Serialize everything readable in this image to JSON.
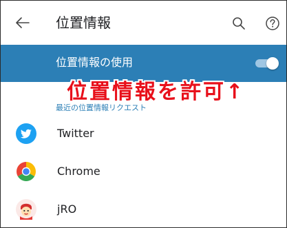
{
  "header": {
    "title": "位置情報",
    "back_icon": "arrow-left-icon",
    "search_icon": "search-icon",
    "help_icon": "help-circle-icon"
  },
  "location_toggle": {
    "label": "位置情報の使用",
    "state": "on"
  },
  "annotation": {
    "text": "位置情報を許可↑",
    "color": "#e8101b"
  },
  "recent_requests": {
    "header": "最近の位置情報リクエスト"
  },
  "apps": [
    {
      "name": "Twitter",
      "icon": "twitter-icon"
    },
    {
      "name": "Chrome",
      "icon": "chrome-icon"
    },
    {
      "name": "jRO",
      "icon": "jro-icon"
    }
  ],
  "colors": {
    "accent": "#2c7fb6",
    "annotation": "#e8101b"
  }
}
